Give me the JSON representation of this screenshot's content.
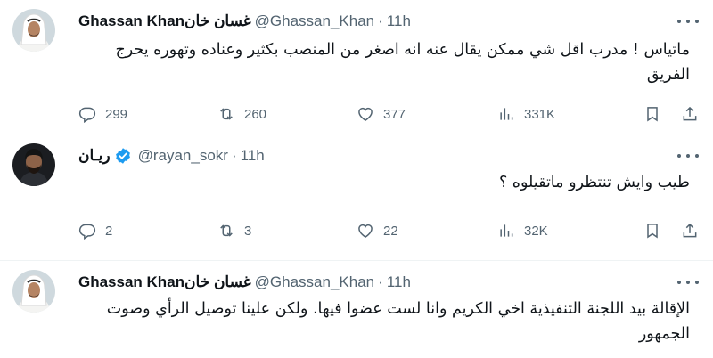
{
  "tweets": [
    {
      "name": "Ghassan Khanغسان خان",
      "handle": "@Ghassan_Khan",
      "dot": "·",
      "time": "11h",
      "verified": false,
      "text": "ماتياس ! مدرب اقل شي ممكن يقال عنه انه اصغر من المنصب بكثير وعناده وتهوره يحرج الفريق",
      "replies": "299",
      "retweets": "260",
      "likes": "377",
      "views": "331K"
    },
    {
      "name": "ريـان",
      "handle": "@rayan_sokr",
      "dot": "·",
      "time": "11h",
      "verified": true,
      "text": "طيب وايش تنتظرو ماتقيلوه ؟",
      "replies": "2",
      "retweets": "3",
      "likes": "22",
      "views": "32K"
    },
    {
      "name": "Ghassan Khanغسان خان",
      "handle": "@Ghassan_Khan",
      "dot": "·",
      "time": "11h",
      "verified": false,
      "text": "الإقالة بيد اللجنة التنفيذية اخي الكريم وانا لست عضوا فيها. ولكن علينا توصيل الرأي وصوت الجمهور"
    }
  ],
  "icons": {
    "reply": "reply-icon",
    "retweet": "retweet-icon",
    "like": "heart-icon",
    "views": "views-icon",
    "bookmark": "bookmark-icon",
    "share": "share-icon",
    "more": "more-icon",
    "verified": "verified-badge-icon"
  },
  "colors": {
    "text": "#0f1419",
    "secondary": "#536471",
    "verified": "#1d9bf0",
    "divider": "#eff3f4"
  }
}
